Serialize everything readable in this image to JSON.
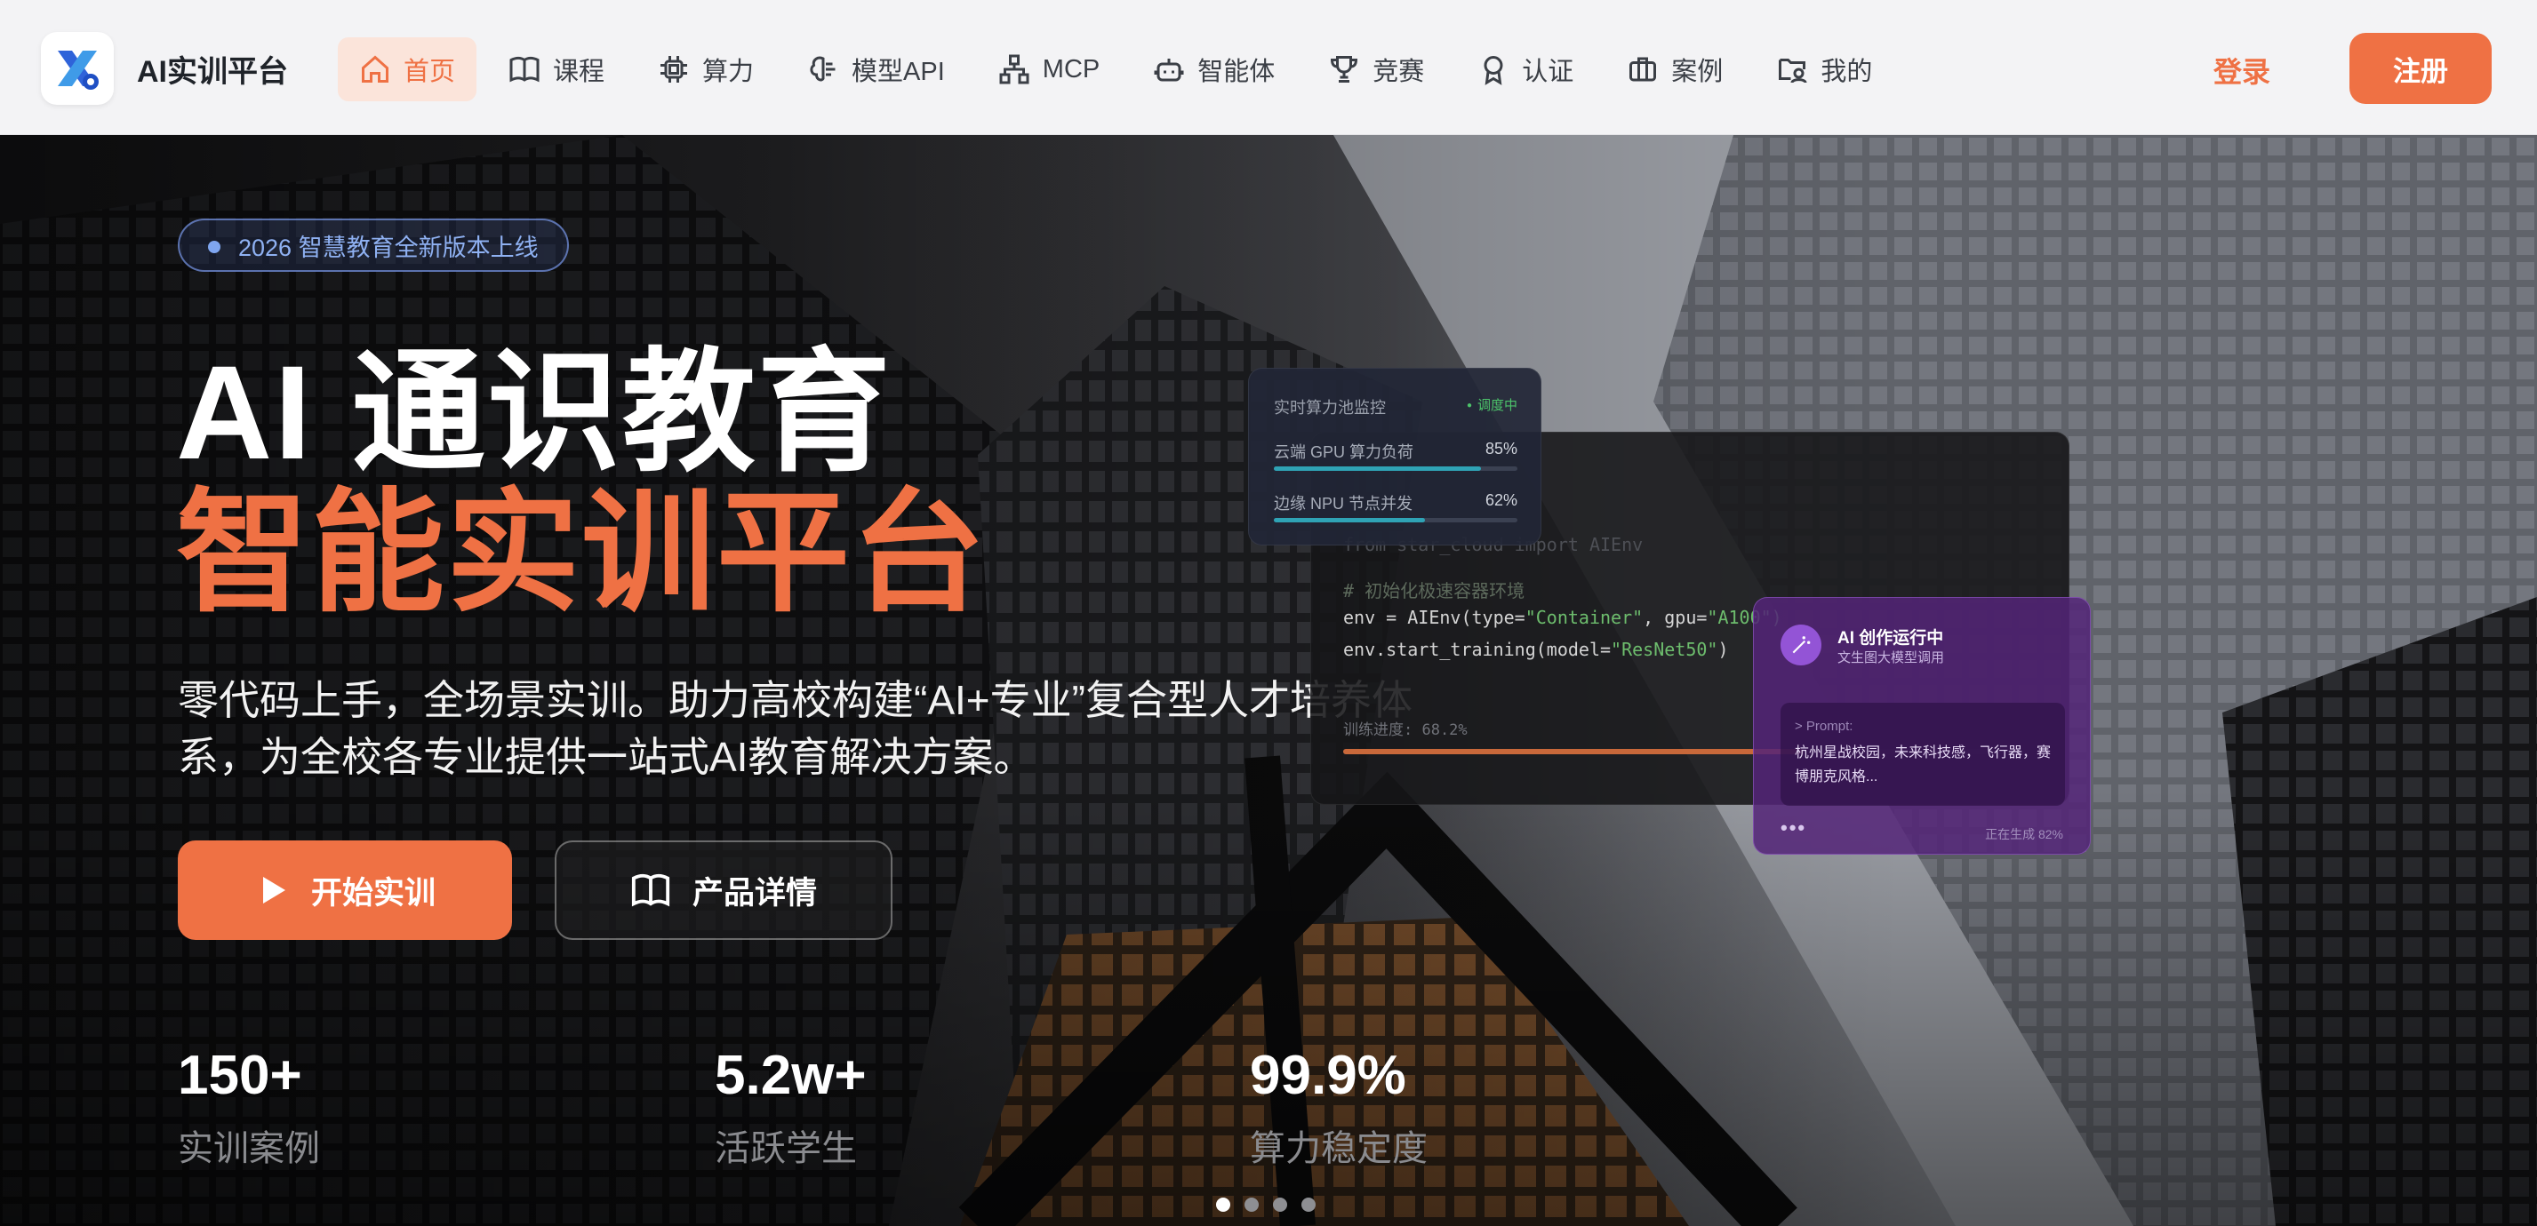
{
  "brand": {
    "name": "AI实训平台"
  },
  "nav": {
    "items": [
      {
        "label": "首页",
        "icon": "home-icon",
        "active": true
      },
      {
        "label": "课程",
        "icon": "book-icon"
      },
      {
        "label": "算力",
        "icon": "chip-icon"
      },
      {
        "label": "模型API",
        "icon": "brain-icon"
      },
      {
        "label": "MCP",
        "icon": "network-icon"
      },
      {
        "label": "智能体",
        "icon": "robot-icon"
      },
      {
        "label": "竞赛",
        "icon": "trophy-icon"
      },
      {
        "label": "认证",
        "icon": "award-icon"
      },
      {
        "label": "案例",
        "icon": "briefcase-icon"
      },
      {
        "label": "我的",
        "icon": "user-folder-icon"
      }
    ],
    "login": "登录",
    "register": "注册"
  },
  "hero": {
    "badge": "2026 智慧教育全新版本上线",
    "title_line1": "AI 通识教育",
    "title_line2": "智能实训平台",
    "subtitle": "零代码上手，全场景实训。助力高校构建“AI+专业”复合型人才培养体系，为全校各专业提供一站式AI教育解决方案。",
    "primary_button": "开始实训",
    "secondary_button": "产品详情",
    "stats": [
      {
        "value": "150+",
        "label": "实训案例"
      },
      {
        "value": "5.2w+",
        "label": "活跃学生"
      },
      {
        "value": "99.9%",
        "label": "算力稳定度"
      }
    ],
    "carousel": {
      "total": 4,
      "active": 1
    }
  },
  "monitor": {
    "title": "实时算力池监控",
    "status": "调度中",
    "rows": [
      {
        "label": "云端 GPU 算力负荷",
        "value": "85%",
        "fill": 0.85
      },
      {
        "label": "边缘 NPU 节点并发",
        "value": "62%",
        "fill": 0.62
      }
    ]
  },
  "code": {
    "line_import": "from star_cloud import AIEnv",
    "comment": "# 初始化极速容器环境",
    "line_env_a": "env = AIEnv(type=",
    "line_env_type": "\"Container\"",
    "line_env_b": ", gpu=",
    "line_env_gpu": "\"A100\")",
    "line_train_a": "env.start_training(model=",
    "line_train_model": "\"ResNet50\"",
    "line_train_b": ")",
    "progress_label": "训练进度: 68.2%",
    "progress": 0.682
  },
  "ai_card": {
    "title": "AI 创作运行中",
    "subtitle": "文生图大模型调用",
    "prompt_label": "> Prompt:",
    "prompt_text": "杭州星战校园，未来科技感，飞行器，赛博朋克风格...",
    "menu": "•••",
    "generating": "正在生成 82%"
  },
  "colors": {
    "accent": "#ef7144",
    "badge": "#8fb1f2",
    "ai_purple": "#542478"
  }
}
